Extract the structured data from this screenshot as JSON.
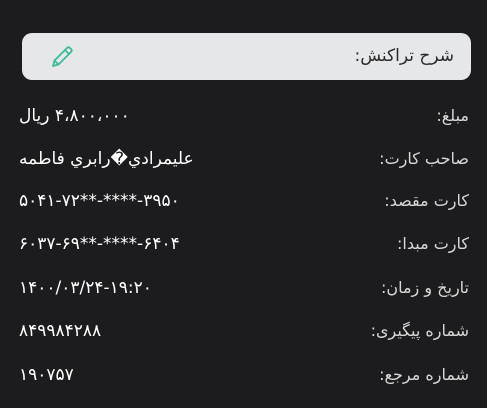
{
  "colors": {
    "background": "#1c1c1e",
    "description_bar": "#e6e7e9",
    "edit_icon": "#3fb99a"
  },
  "description": {
    "label": "شرح تراکنش:",
    "edit_icon": "pencil-icon"
  },
  "details": [
    {
      "label": "مبلغ:",
      "value": "۴،۸۰۰،۰۰۰ ریال"
    },
    {
      "label": "صاحب کارت:",
      "value": "عليمرادي�رابري فاطمه"
    },
    {
      "label": "کارت مقصد:",
      "value": "۵۰۴۱-۷۲**-****-۳۹۵۰"
    },
    {
      "label": "کارت مبدا:",
      "value": "۶۰۳۷-۶۹**-****-۶۴۰۴"
    },
    {
      "label": "تاریخ و زمان:",
      "value": "۱۴۰۰/۰۳/۲۴-۱۹:۲۰"
    },
    {
      "label": "شماره پیگیری:",
      "value": "۸۴۹۹۸۴۲۸۸"
    },
    {
      "label": "شماره مرجع:",
      "value": "۱۹۰۷۵۷"
    }
  ]
}
